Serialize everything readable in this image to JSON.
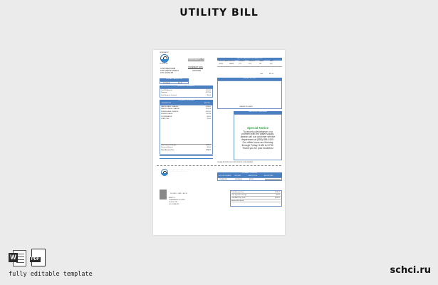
{
  "heading": "UTILITY BILL",
  "footer": {
    "caption": "fully editable template",
    "brand": "schci.ru"
  },
  "icons": [
    "word-icon",
    "pdf-icon"
  ],
  "file_formats": {
    "word": "W",
    "pdf": "PDF"
  },
  "colors": {
    "accent": "#4a7fc1",
    "notice_green": "#3aa84b",
    "page_bg": "#ebebeb"
  },
  "bill": {
    "company": {
      "name": "GREENWATER",
      "subtitle": "UTILITIES INC"
    },
    "account_label": "ACCOUNT NUMBER",
    "customer": [
      "CUSTOMER NAME",
      "1234 SAMPLE STREET",
      "CITY, STATE ZIP"
    ],
    "statement_label": "STATEMENT DATE",
    "statement_date": "04/01/2020",
    "table_header": "METER READING INFORMATION",
    "table_cols": [
      "METER NUMBER",
      "SERVICE",
      "CURRENT",
      "PREVIOUS",
      "USAGE",
      "RATE"
    ],
    "table_row": [
      "123456",
      "WATER",
      "1775",
      "1512",
      "263",
      "0.04"
    ],
    "total_label": "Total",
    "total_value": "$24.18",
    "due_label": "DUE DATE",
    "due_value": "04/25/2020",
    "amount_label": "AMOUNT DUE",
    "amount_value": "$78.57",
    "summary_header": "ACCOUNT SUMMARY",
    "summary": [
      {
        "label": "Last Bill Amount",
        "value": "$72.30"
      },
      {
        "label": "Payment",
        "value": "-$72.30"
      },
      {
        "label": "Total Balance Forward",
        "value": "$0.00"
      }
    ],
    "usage_header": "USAGE HISTORY",
    "current_header": "CURRENT CHARGES",
    "charges_cols": [
      "DESCRIPTION",
      "AMOUNT"
    ],
    "charges": [
      {
        "label": "WATER BASE CHARGE",
        "value": "$18.00"
      },
      {
        "label": "WATER USAGE CHARGE",
        "value": "$24.18"
      },
      {
        "label": "SEWER BASE CHARGE",
        "value": "$20.00"
      },
      {
        "label": "SEWER USAGE",
        "value": "$11.39"
      },
      {
        "label": "STORMWATER",
        "value": "$5.00"
      },
      {
        "label": "STATE TAX",
        "value": "$1.00"
      }
    ],
    "totals": [
      {
        "label": "Total Current Charges",
        "value": "$78.57"
      },
      {
        "label": "Previous Balance",
        "value": "$0.00"
      },
      {
        "label": "Total Amount Due",
        "value": "$78.57"
      }
    ],
    "usage_note": "CHANGE IN USAGE",
    "important_header": "IMPORTANT MESSAGE",
    "notice_title": "Special Notice",
    "notice_text": [
      "To report a disturbance or a",
      "problem with the water supply,",
      "please call our customer service",
      "department at (555) 555-0100.",
      "Our office hours are Monday",
      "through Friday, 8 AM to 5 PM.",
      "Thank you for your business!"
    ],
    "return_note": "PLEASE RETURN THIS PORTION WITH YOUR PAYMENT",
    "payment_header": "PAYMENT COUPON",
    "payment_cols": [
      "ACCOUNT NUMBER",
      "DUE DATE",
      "AMOUNT DUE",
      "AMOUNT PAID"
    ],
    "payment_row": [
      "123456-789",
      "04/25/2020",
      "$78.57",
      ""
    ],
    "coupon_lines": [
      {
        "label": "Total Amount Due",
        "value": "$78.57"
      },
      {
        "label": "Late Payment Charge",
        "value": "$5.00"
      },
      {
        "label": "Total After Due Date",
        "value": "$83.57"
      },
      {
        "label": "Amount Enclosed",
        "value": ""
      }
    ],
    "remit_label": "REMIT TO:",
    "remit": [
      "GREENWATER UTILITIES",
      "PO BOX 1234",
      "CITY, STATE ZIP"
    ]
  }
}
